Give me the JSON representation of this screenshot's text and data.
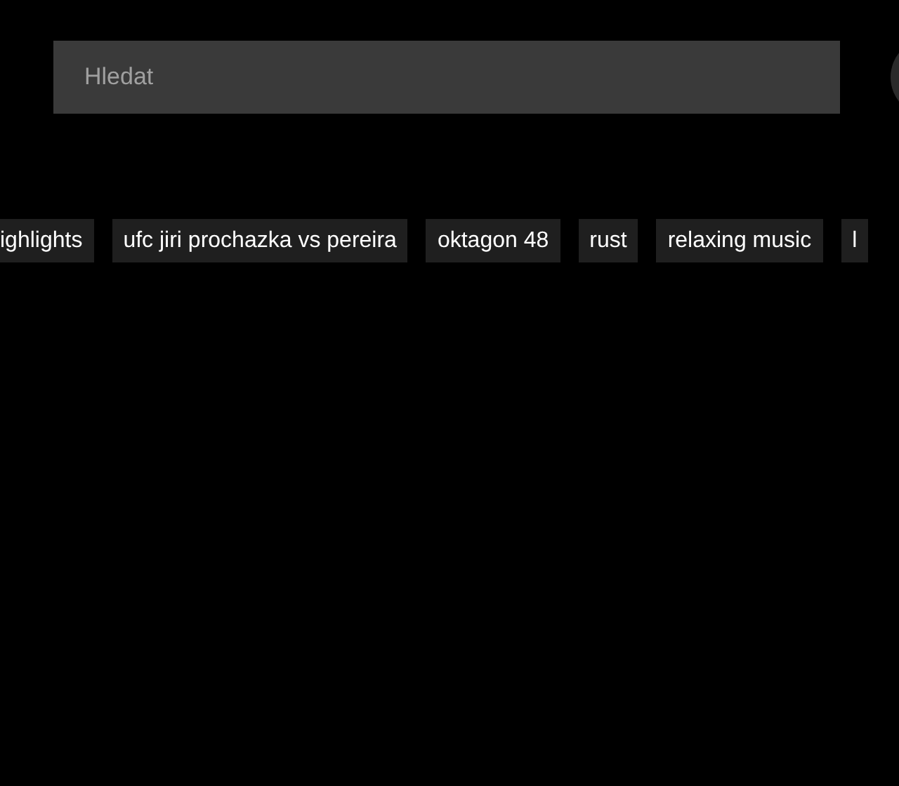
{
  "search": {
    "placeholder": "Hledat"
  },
  "chips": [
    "ighlights",
    "ufc jiri prochazka vs pereira",
    "oktagon 48",
    "rust",
    "relaxing music",
    "l"
  ]
}
